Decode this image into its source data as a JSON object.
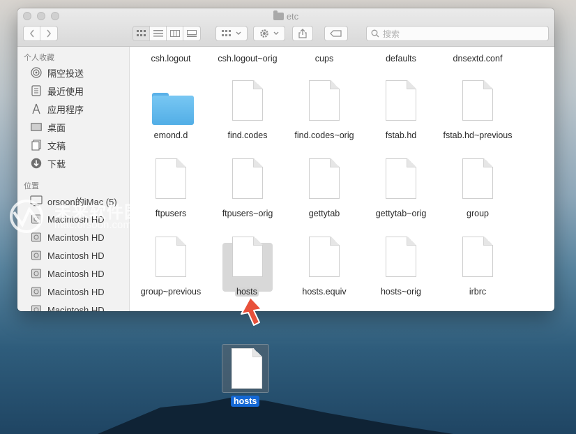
{
  "window": {
    "title": "etc"
  },
  "toolbar": {
    "search_placeholder": "搜索",
    "colors": {
      "bar": "#e3e3e3",
      "border": "#c7c7c7"
    }
  },
  "sidebar": {
    "favorites_header": "个人收藏",
    "favorites": [
      {
        "label": "隔空投送",
        "icon": "airdrop-icon"
      },
      {
        "label": "最近使用",
        "icon": "recents-icon"
      },
      {
        "label": "应用程序",
        "icon": "applications-icon"
      },
      {
        "label": "桌面",
        "icon": "desktop-icon"
      },
      {
        "label": "文稿",
        "icon": "documents-icon"
      },
      {
        "label": "下载",
        "icon": "downloads-icon"
      }
    ],
    "locations_header": "位置",
    "locations": [
      {
        "label": "orsoon的iMac (5)",
        "icon": "imac-icon"
      },
      {
        "label": "Macintosh HD",
        "icon": "disk-icon"
      },
      {
        "label": "Macintosh HD",
        "icon": "disk-icon"
      },
      {
        "label": "Macintosh HD",
        "icon": "disk-icon"
      },
      {
        "label": "Macintosh HD",
        "icon": "disk-icon"
      },
      {
        "label": "Macintosh HD",
        "icon": "disk-icon"
      },
      {
        "label": "Macintosh HD",
        "icon": "disk-icon"
      }
    ]
  },
  "files": {
    "row0": [
      "csh.logout",
      "csh.logout~orig",
      "cups",
      "defaults",
      "dnsextd.conf"
    ],
    "row1": [
      "emond.d",
      "find.codes",
      "find.codes~orig",
      "fstab.hd",
      "fstab.hd~previous"
    ],
    "row2": [
      "ftpusers",
      "ftpusers~orig",
      "gettytab",
      "gettytab~orig",
      "group"
    ],
    "row3": [
      "group~previous",
      "hosts",
      "hosts.equiv",
      "hosts~orig",
      "irbrc"
    ],
    "selected": "hosts"
  },
  "drag": {
    "label": "hosts"
  },
  "watermark": {
    "line1": "未来软件园",
    "line2": "mac.orsoon.com"
  },
  "colors": {
    "selection_blue": "#1468d6",
    "folder_blue": "#5ab1e8",
    "arrow_red": "#e8503a"
  }
}
